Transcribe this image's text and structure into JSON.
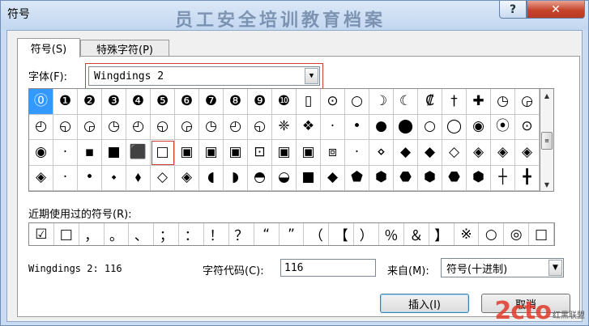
{
  "window": {
    "title": "符号",
    "background_doc_title": "员工安全培训教育档案",
    "help_label": "?",
    "close_label": "✕"
  },
  "tabs": [
    {
      "label": "符号(S)"
    },
    {
      "label": "特殊字符(P)"
    }
  ],
  "font": {
    "label": "字体(F):",
    "value": "Wingdings 2"
  },
  "symbols": [
    "⓪",
    "❶",
    "❷",
    "❸",
    "❹",
    "❺",
    "❻",
    "❼",
    "❽",
    "❾",
    "❿",
    "▯",
    "⊙",
    "○",
    "☽",
    "☾",
    "₡",
    "†",
    "✚",
    "◷",
    "◶",
    "◴",
    "◵",
    "◶",
    "◷",
    "◴",
    "◵",
    "◶",
    "◷",
    "◴",
    "◵",
    "❈",
    "❖",
    "·",
    "•",
    "●",
    "⬤",
    "○",
    "◯",
    "◉",
    "⦿",
    "⊙",
    "◉",
    "·",
    "▪",
    "■",
    "⬛",
    "□",
    "▣",
    "▣",
    "▣",
    "⊡",
    "▣",
    "▣",
    "⧈",
    "·",
    "⋄",
    "◆",
    "◆",
    "◇",
    "◈",
    "◈",
    "◈",
    "◈",
    "·",
    "•",
    "⬩",
    "⬧",
    "◇",
    "◈",
    "◖",
    "◗",
    "◓",
    "◒",
    "■",
    "◆",
    "⬟",
    "⬢",
    "⬣",
    "⬢",
    "⬣",
    "⬢",
    "┼",
    "╋"
  ],
  "selected_index": 0,
  "highlight_index": 47,
  "recent": {
    "label": "近期使用过的符号(R):",
    "items": [
      "☑",
      "□",
      "，",
      "。",
      "、",
      "；",
      "：",
      "！",
      "？",
      "“",
      "”",
      "（",
      "【",
      "）",
      "％",
      "＆",
      "】",
      "※",
      "○",
      "◎",
      "□"
    ]
  },
  "status": {
    "font_code": "Wingdings 2: 116"
  },
  "char_code": {
    "label": "字符代码(C):",
    "value": "116"
  },
  "from": {
    "label": "来自(M):",
    "value": "符号(十进制)"
  },
  "buttons": {
    "insert": "插入(I)",
    "cancel": "取消"
  },
  "watermark": {
    "logo": "2cto",
    "site": "红黑联盟"
  }
}
